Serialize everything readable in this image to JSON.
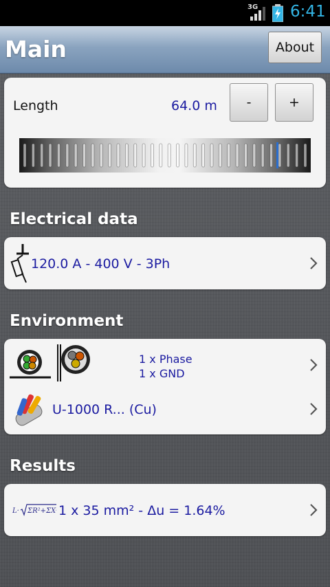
{
  "status_bar": {
    "network": "3G",
    "time": "6:41",
    "icons": [
      "signal-icon",
      "battery-charging-icon"
    ]
  },
  "header": {
    "title": "Main",
    "about_label": "About"
  },
  "length": {
    "label": "Length",
    "value": "64.0 m",
    "minus_label": "-",
    "plus_label": "+"
  },
  "electrical": {
    "section_title": "Electrical data",
    "summary": "120.0 A - 400 V - 3Ph",
    "icon": "fuse-icon"
  },
  "environment": {
    "section_title": "Environment",
    "conductors": [
      "1 x Phase",
      "1 x GND"
    ],
    "cable": "U-1000 R... (Cu)",
    "icons": [
      "cable-installation-icon",
      "cable-cross-section-icon",
      "cable-bundle-icon"
    ]
  },
  "results": {
    "section_title": "Results",
    "summary": "1 x 35 mm² - Δu = 1.64%",
    "icon": "formula-icon"
  },
  "colors": {
    "accent_blue": "#1a1aa0",
    "status_time": "#33b5e5"
  }
}
